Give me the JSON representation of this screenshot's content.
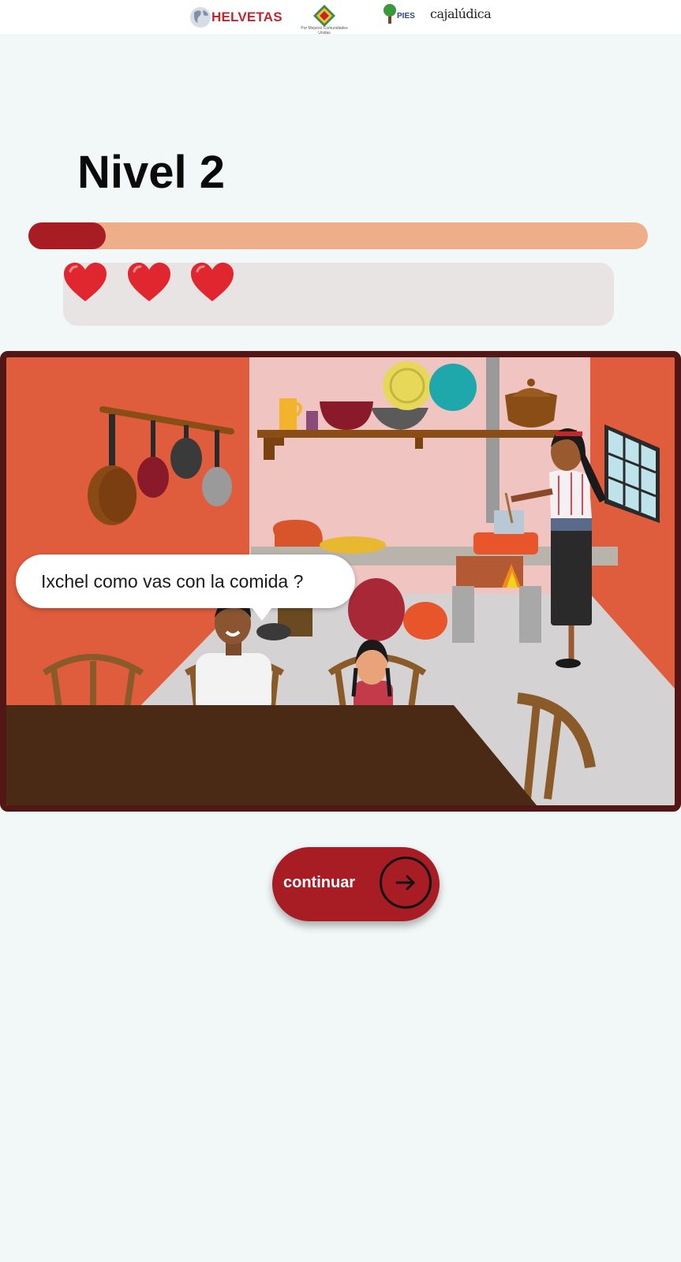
{
  "header": {
    "logos": [
      {
        "name": "HELVETAS",
        "text": "HELVETAS"
      },
      {
        "name": "Asociación",
        "text": "Por Mejores Comunidades Unidas"
      },
      {
        "name": "PIES de Occidente",
        "text": "PIES"
      },
      {
        "name": "Caja Lúdica",
        "text": "cajalúdica"
      }
    ]
  },
  "game": {
    "level_title": "Nivel 2",
    "progress": 0.125,
    "lives": 3,
    "colors": {
      "primary": "#a81c23",
      "progress_track": "#eeae89",
      "lives_panel": "#e7e4e3",
      "background": "#f2f7f8"
    }
  },
  "scene": {
    "dialogue": "Ixchel como vas con la comida ?"
  },
  "actions": {
    "continue_label": "continuar",
    "continue_icon": "arrow-right-icon"
  }
}
